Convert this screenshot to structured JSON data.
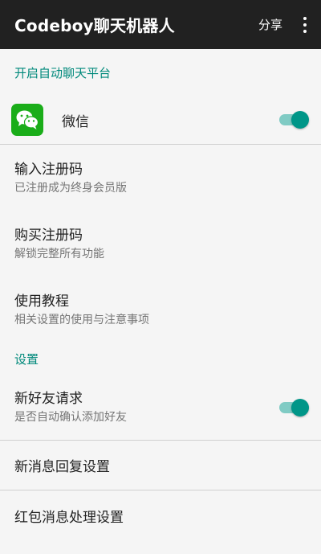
{
  "toolbar": {
    "title": "Codeboy聊天机器人",
    "share_label": "分享",
    "more_icon": "more-vert-icon"
  },
  "sections": {
    "platform_header": "开启自动聊天平台",
    "settings_header": "设置"
  },
  "wechat": {
    "label": "微信",
    "icon": "wechat-icon",
    "enabled": true
  },
  "items": {
    "register": {
      "title": "输入注册码",
      "subtitle": "已注册成为终身会员版"
    },
    "buy": {
      "title": "购买注册码",
      "subtitle": "解锁完整所有功能"
    },
    "tutorial": {
      "title": "使用教程",
      "subtitle": "相关设置的使用与注意事项"
    },
    "friend_request": {
      "title": "新好友请求",
      "subtitle": "是否自动确认添加好友",
      "enabled": true
    },
    "message_reply": {
      "title": "新消息回复设置"
    },
    "red_packet": {
      "title": "红包消息处理设置"
    }
  },
  "colors": {
    "toolbar_bg": "#212121",
    "accent": "#00897b",
    "switch_thumb": "#009688",
    "switch_track": "#80cbc4",
    "wechat_green": "#1aad19"
  }
}
